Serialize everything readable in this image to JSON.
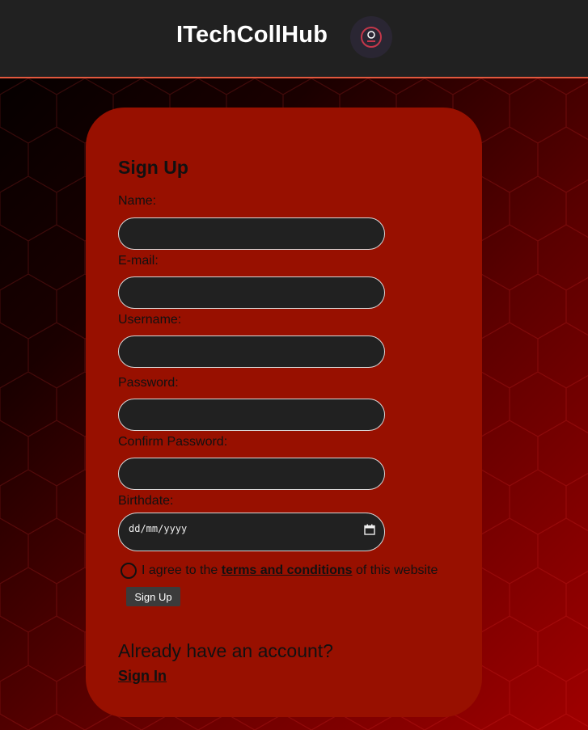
{
  "header": {
    "brand": "ITechCollHub",
    "logo_icon": "logo-icon"
  },
  "form": {
    "title": "Sign Up",
    "fields": [
      {
        "label": "Name:",
        "value": "",
        "type": "text"
      },
      {
        "label": "E-mail:",
        "value": "",
        "type": "email"
      },
      {
        "label": "Username:",
        "value": "",
        "type": "text"
      },
      {
        "label": "Password:",
        "value": "",
        "type": "password"
      },
      {
        "label": "Confirm Password:",
        "value": "",
        "type": "password"
      },
      {
        "label": "Birthdate:",
        "placeholder": "dd/mm/yyyy",
        "type": "date"
      }
    ],
    "terms": {
      "prefix": "I agree to the ",
      "link": "terms and conditions",
      "suffix": " of this website",
      "checked": false
    },
    "submit_label": "Sign Up"
  },
  "footer": {
    "prompt": "Already have an account?",
    "signin_label": "Sign In"
  },
  "colors": {
    "card": "#981000",
    "header": "#212121",
    "header_border": "#e2573d",
    "input_bg": "#212121"
  }
}
